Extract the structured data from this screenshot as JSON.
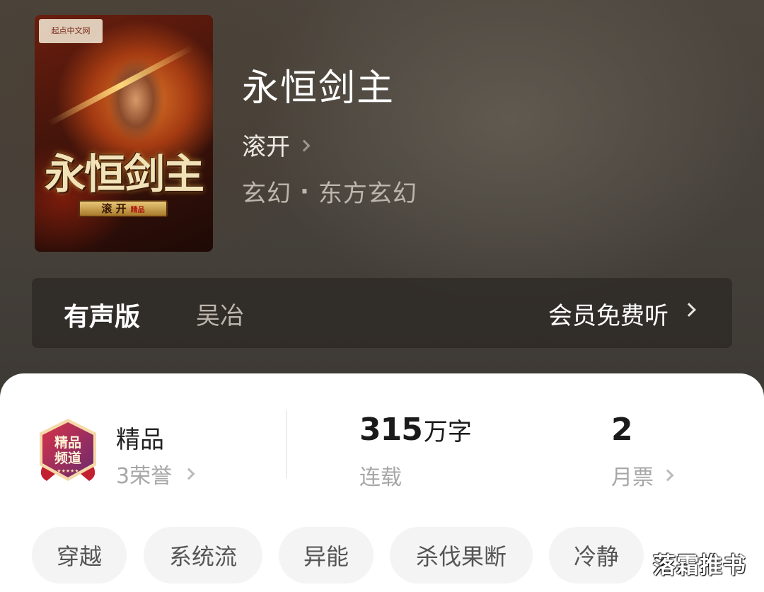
{
  "book": {
    "title": "永恒剑主",
    "author": "滚开",
    "genre": "玄幻",
    "subgenre": "东方玄幻",
    "genre_separator": "·"
  },
  "cover": {
    "publisher_text": "起点中文网",
    "title_art": "永恒剑主",
    "author_art": "滚 开",
    "mark": "精品"
  },
  "audio": {
    "label": "有声版",
    "narrator": "吴冶",
    "listen_label": "会员免费听"
  },
  "stats": {
    "badge_text": "精品",
    "honors": "3荣誉",
    "word_count": "315",
    "word_unit": "万字",
    "status": "连载",
    "monthly_ticket_count": "2",
    "monthly_ticket_label": "月票"
  },
  "tags": [
    "穿越",
    "系统流",
    "异能",
    "杀伐果断",
    "冷静"
  ],
  "watermark": "落霜推书",
  "colors": {
    "hero_bg": "#47423b",
    "audio_bar_bg": "#2c2824",
    "badge_red": "#b4263a",
    "badge_purple": "#6b2a6e",
    "tag_bg": "#f4f4f4"
  }
}
